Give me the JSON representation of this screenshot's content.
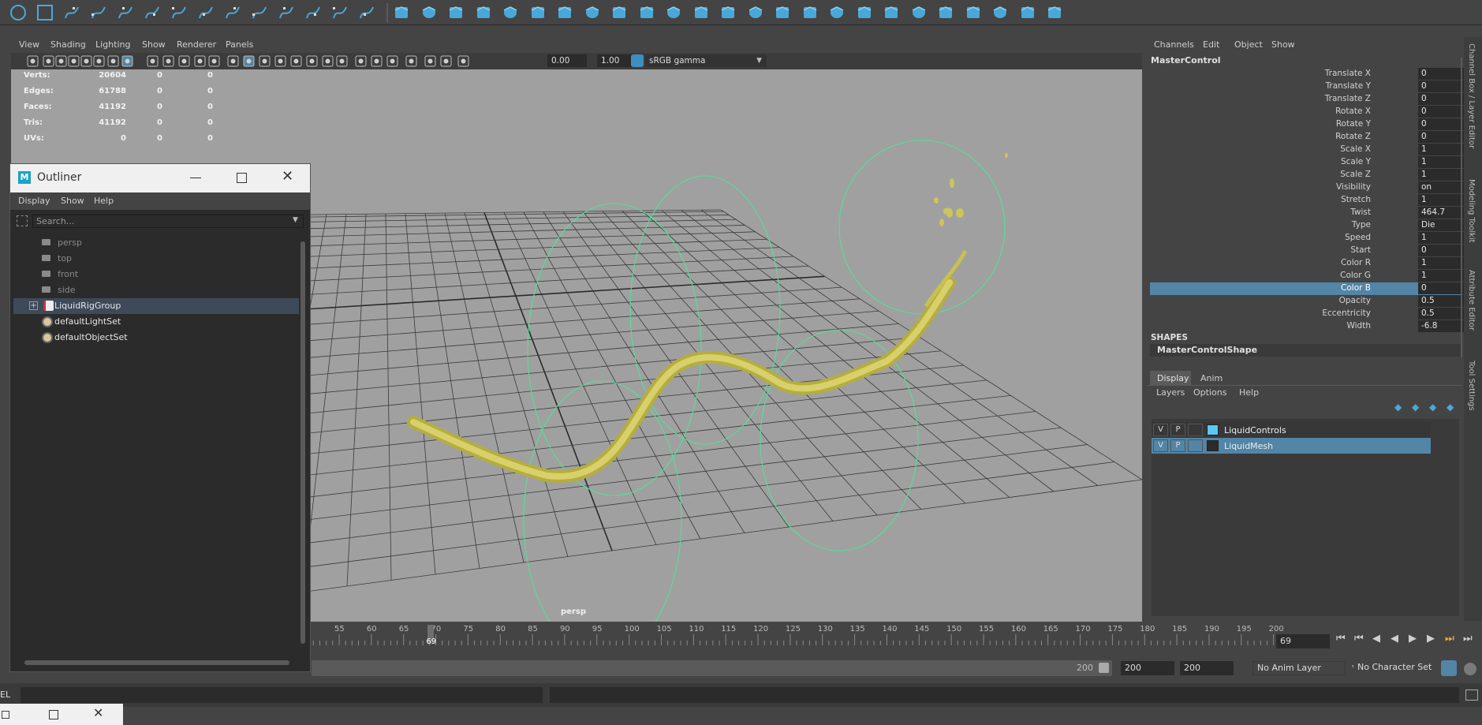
{
  "shelf": {
    "icons": [
      "circle-curve-icon",
      "square-curve-icon",
      "cv-curve-icon",
      "pencil-curve-icon",
      "ep-curve-icon",
      "bezier-curve-icon",
      "curve-intersect-icon",
      "curve-tool-icon",
      "curve-edit-icon",
      "arc-tool-icon",
      "rebuild-curve-icon",
      "offset-curve-icon",
      "cut-curve-icon",
      "curve-warp-icon",
      "sphere-icon",
      "cube-icon",
      "cylinder-icon",
      "cone-icon",
      "diamond-icon",
      "torus-icon",
      "pipe-icon",
      "helix-icon",
      "gear-icon",
      "sweep-icon",
      "bend-icon",
      "box-icon",
      "bevel-icon",
      "combine-icon",
      "extrude-icon",
      "bridge-icon",
      "fill-hole-icon",
      "multi-cut-icon",
      "insert-loop-icon",
      "merge-icon",
      "target-weld-icon",
      "quad-draw-icon",
      "bar-chart-icon",
      "brush-icon",
      "mesh-tool-icon"
    ]
  },
  "viewport": {
    "menu": [
      "View",
      "Shading",
      "Lighting",
      "Show",
      "Renderer",
      "Panels"
    ],
    "toolbar": {
      "exposure": "0.00",
      "gamma": "1.00",
      "color_space": "sRGB gamma"
    },
    "hud": {
      "rows": [
        {
          "label": "Verts:",
          "v1": "20604",
          "v2": "0",
          "v3": "0"
        },
        {
          "label": "Edges:",
          "v1": "61788",
          "v2": "0",
          "v3": "0"
        },
        {
          "label": "Faces:",
          "v1": "41192",
          "v2": "0",
          "v3": "0"
        },
        {
          "label": "Tris:",
          "v1": "41192",
          "v2": "0",
          "v3": "0"
        },
        {
          "label": "UVs:",
          "v1": "0",
          "v2": "0",
          "v3": "0"
        }
      ]
    },
    "camera_label": "persp"
  },
  "timeline": {
    "ticks": [
      "55",
      "60",
      "65",
      "70",
      "75",
      "80",
      "85",
      "90",
      "95",
      "100",
      "105",
      "110",
      "115",
      "120",
      "125",
      "130",
      "135",
      "140",
      "145",
      "150",
      "155",
      "160",
      "165",
      "170",
      "175",
      "180",
      "185",
      "190",
      "195",
      "200"
    ],
    "current_frame": "69",
    "current_field": "69"
  },
  "range": {
    "end_slider": "200",
    "anim_end": "200",
    "playback_end": "200",
    "anim_layer": "No Anim Layer",
    "char_set": "No Character Set"
  },
  "cmdline": {
    "mel_label": "EL"
  },
  "channel_box": {
    "menu": [
      "Channels",
      "Edit",
      "Object",
      "Show"
    ],
    "node": "MasterControl",
    "attributes": [
      {
        "label": "Translate X",
        "value": "0"
      },
      {
        "label": "Translate Y",
        "value": "0"
      },
      {
        "label": "Translate Z",
        "value": "0"
      },
      {
        "label": "Rotate X",
        "value": "0"
      },
      {
        "label": "Rotate Y",
        "value": "0"
      },
      {
        "label": "Rotate Z",
        "value": "0"
      },
      {
        "label": "Scale X",
        "value": "1"
      },
      {
        "label": "Scale Y",
        "value": "1"
      },
      {
        "label": "Scale Z",
        "value": "1"
      },
      {
        "label": "Visibility",
        "value": "on"
      },
      {
        "label": "Stretch",
        "value": "1"
      },
      {
        "label": "Twist",
        "value": "464.7"
      },
      {
        "label": "Type",
        "value": "Die"
      },
      {
        "label": "Speed",
        "value": "1"
      },
      {
        "label": "Start",
        "value": "0"
      },
      {
        "label": "Color R",
        "value": "1"
      },
      {
        "label": "Color G",
        "value": "1"
      },
      {
        "label": "Color B",
        "value": "0"
      },
      {
        "label": "Opacity",
        "value": "0.5"
      },
      {
        "label": "Eccentricity",
        "value": "0.5"
      },
      {
        "label": "Width",
        "value": "-6.8"
      }
    ],
    "shapes_header": "SHAPES",
    "shape_node": "MasterControlShape"
  },
  "layer_editor": {
    "tabs": [
      "Display",
      "Anim"
    ],
    "menu": [
      "Layers",
      "Options",
      "Help"
    ],
    "layers": [
      {
        "v": "V",
        "p": "P",
        "name": "LiquidControls",
        "color": "#5ac8f0"
      },
      {
        "v": "V",
        "p": "P",
        "name": "LiquidMesh",
        "color": ""
      }
    ]
  },
  "side_tabs": [
    "Channel Box / Layer Editor",
    "Modeling Toolkit",
    "Attribute Editor",
    "Tool Settings"
  ],
  "outliner": {
    "title": "Outliner",
    "menu": [
      "Display",
      "Show",
      "Help"
    ],
    "search_placeholder": "Search...",
    "items": [
      {
        "label": "persp",
        "type": "camera"
      },
      {
        "label": "top",
        "type": "camera"
      },
      {
        "label": "front",
        "type": "camera"
      },
      {
        "label": "side",
        "type": "camera"
      },
      {
        "label": "LiquidRigGroup",
        "type": "group"
      },
      {
        "label": "defaultLightSet",
        "type": "set"
      },
      {
        "label": "defaultObjectSet",
        "type": "set"
      }
    ]
  },
  "colors": {
    "accent": "#5285a6",
    "shelf_icon": "#4aa8d8",
    "grid": "#3a3a3a",
    "curves": "#52e09a",
    "liquid": "#cfc75a"
  }
}
